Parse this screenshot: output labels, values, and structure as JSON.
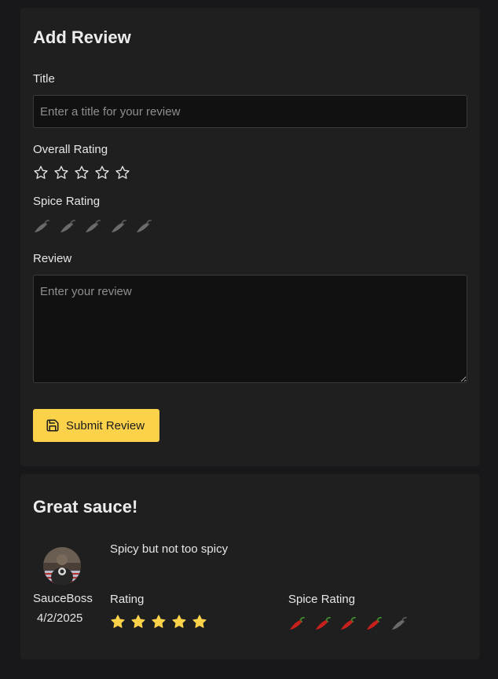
{
  "add_review": {
    "heading": "Add Review",
    "title_label": "Title",
    "title_placeholder": "Enter a title for your review",
    "title_value": "",
    "overall_label": "Overall Rating",
    "overall_value": 0,
    "overall_max": 5,
    "spice_label": "Spice Rating",
    "spice_value": 0,
    "spice_max": 5,
    "review_label": "Review",
    "review_placeholder": "Enter your review",
    "review_value": "",
    "submit_label": "Submit Review",
    "submit_icon": "save-icon"
  },
  "review": {
    "title": "Great sauce!",
    "body": "Spicy but not too spicy",
    "author": "SauceBoss",
    "date": "4/2/2025",
    "rating_label": "Rating",
    "rating_value": 5,
    "rating_max": 5,
    "spice_label": "Spice Rating",
    "spice_value": 4,
    "spice_max": 5
  },
  "colors": {
    "background": "#18181b",
    "card": "#1f1f1f",
    "accent": "#fdd24b",
    "star_filled": "#fdd24b",
    "pepper_red": "#c8201c",
    "pepper_empty": "#6b6b6b"
  }
}
